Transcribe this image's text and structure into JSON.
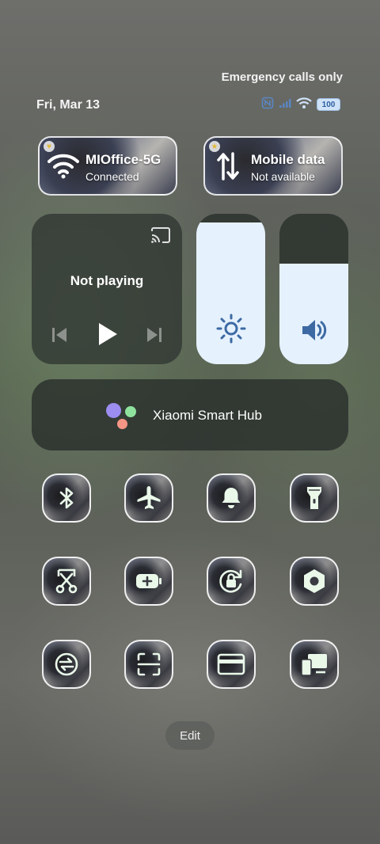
{
  "status": {
    "carrier_text": "Emergency calls only",
    "date": "Fri, Mar 13",
    "battery": "100"
  },
  "network": {
    "wifi": {
      "title": "MIOffice-5G",
      "subtitle": "Connected"
    },
    "mobile": {
      "title": "Mobile data",
      "subtitle": "Not available"
    }
  },
  "media": {
    "status": "Not playing"
  },
  "sliders": {
    "brightness": {
      "level": 0.94
    },
    "volume": {
      "level": 0.67
    }
  },
  "hub": {
    "label": "Xiaomi Smart Hub",
    "colors": [
      "#9c8df0",
      "#8ee29e",
      "#f59585"
    ]
  },
  "toggles": [
    {
      "icon": "bluetooth-icon"
    },
    {
      "icon": "airplane-icon"
    },
    {
      "icon": "bell-icon"
    },
    {
      "icon": "flashlight-icon"
    },
    {
      "icon": "scissors-screenshot-icon"
    },
    {
      "icon": "battery-saver-icon"
    },
    {
      "icon": "rotation-lock-icon"
    },
    {
      "icon": "settings-hex-icon"
    },
    {
      "icon": "sync-icon"
    },
    {
      "icon": "scan-icon"
    },
    {
      "icon": "card-icon"
    },
    {
      "icon": "cast-screen-icon"
    }
  ],
  "edit_label": "Edit",
  "accent": {
    "glyph": "#e9f8e9",
    "slider_fill": "#e5f1fd",
    "slider_icon": "#3d6aa3"
  }
}
